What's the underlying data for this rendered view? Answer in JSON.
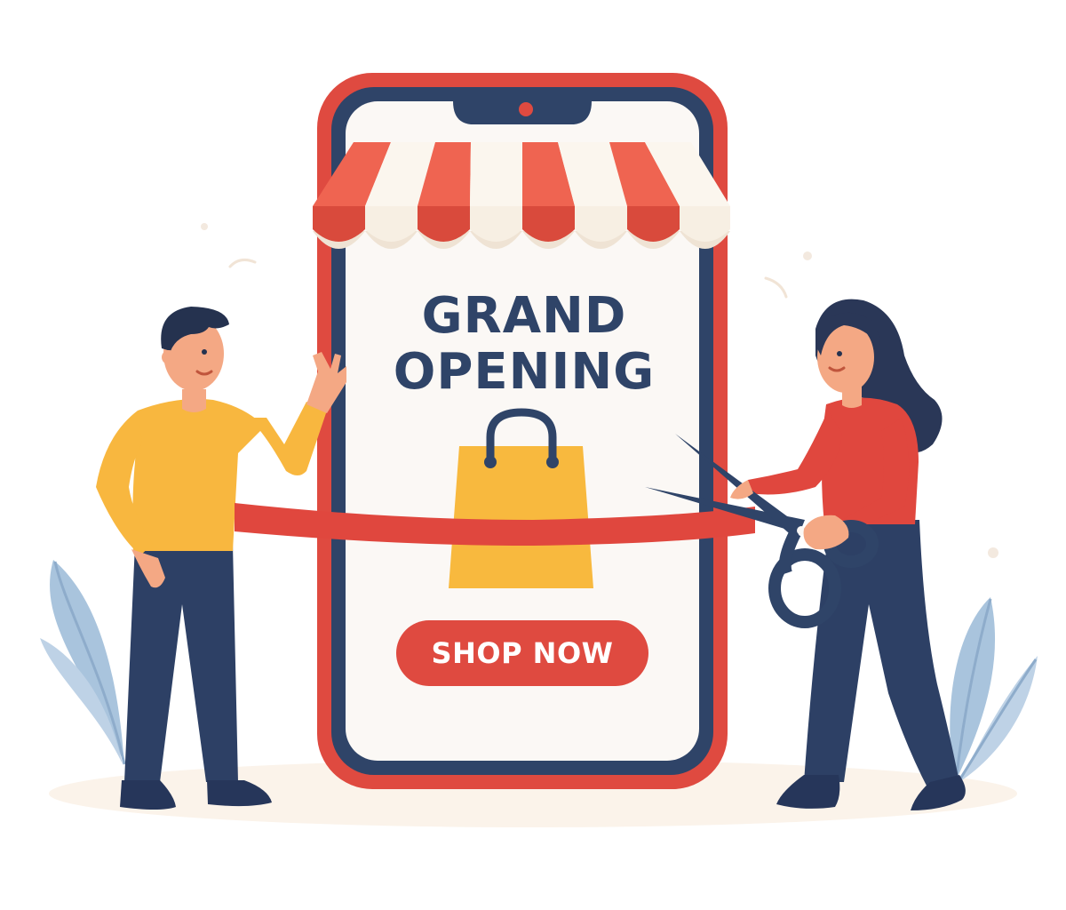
{
  "headline": {
    "line1": "GRAND",
    "line2": "OPENING"
  },
  "cta": {
    "label": "SHOP NOW"
  },
  "colors": {
    "accent_red": "#df4a40",
    "navy": "#2f4468",
    "bag_yellow": "#f8b93e",
    "shirt_yellow": "#f8b73f",
    "leaf_blue": "#a9c4dd",
    "awning_light": "#fbf6ee"
  },
  "icons": {
    "bag": "shopping-bag-icon",
    "scissors": "scissors-icon"
  }
}
